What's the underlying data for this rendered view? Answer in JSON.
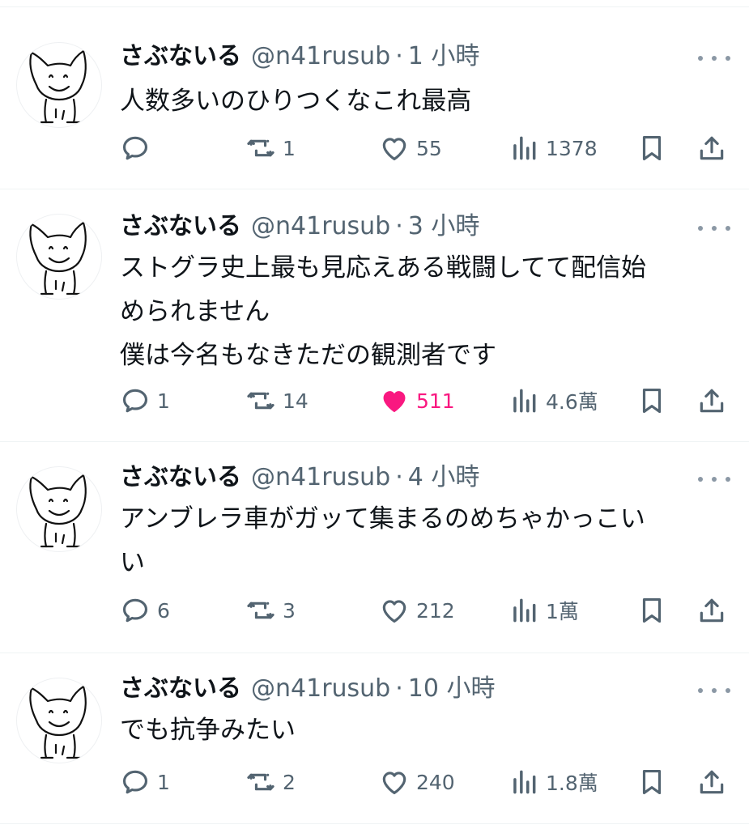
{
  "colors": {
    "text": "#0f1419",
    "secondary": "#536471",
    "like_active": "#f91880",
    "divider": "#eff3f4"
  },
  "tweets": [
    {
      "name": "さぶないる",
      "handle": "@n41rusub",
      "separator": "·",
      "time": "1 小時",
      "lines": [
        "人数多いのひりつくなこれ最高"
      ],
      "replies": "",
      "retweets": "1",
      "likes": "55",
      "liked": false,
      "views": "1378"
    },
    {
      "name": "さぶないる",
      "handle": "@n41rusub",
      "separator": "·",
      "time": "3 小時",
      "lines": [
        "ストグラ史上最も見応えある戦闘してて配信始",
        "められません",
        "僕は今名もなきただの観測者です"
      ],
      "replies": "1",
      "retweets": "14",
      "likes": "511",
      "liked": true,
      "views": "4.6萬"
    },
    {
      "name": "さぶないる",
      "handle": "@n41rusub",
      "separator": "·",
      "time": "4 小時",
      "lines": [
        "アンブレラ車がガッて集まるのめちゃかっこい",
        "い"
      ],
      "replies": "6",
      "retweets": "3",
      "likes": "212",
      "liked": false,
      "views": "1萬"
    },
    {
      "name": "さぶないる",
      "handle": "@n41rusub",
      "separator": "·",
      "time": "10 小時",
      "lines": [
        "でも抗争みたい"
      ],
      "replies": "1",
      "retweets": "2",
      "likes": "240",
      "liked": false,
      "views": "1.8萬"
    }
  ],
  "icons": [
    "avatar-cat-drawing",
    "more-icon",
    "reply-icon",
    "retweet-icon",
    "like-icon",
    "views-icon",
    "bookmark-icon",
    "share-icon"
  ]
}
